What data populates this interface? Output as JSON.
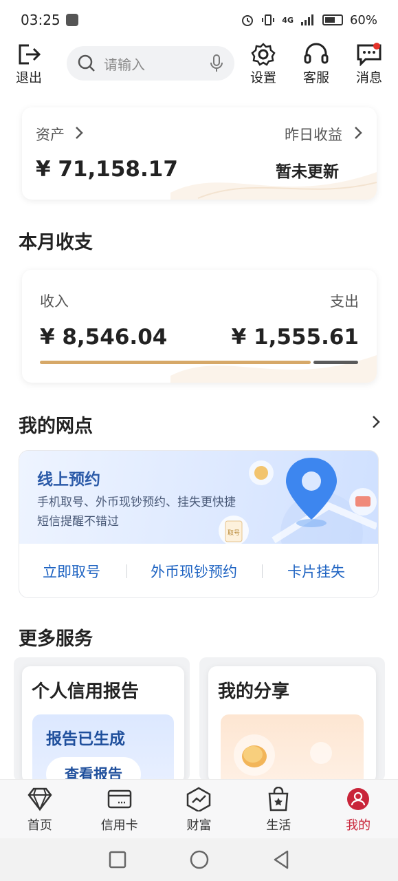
{
  "status": {
    "time": "03:25",
    "signal": "4G",
    "battery": "60%"
  },
  "header": {
    "logout_label": "退出",
    "search_placeholder": "请输入",
    "settings_label": "设置",
    "service_label": "客服",
    "messages_label": "消息"
  },
  "assets": {
    "label": "资产",
    "value": "¥ 71,158.17",
    "yesterday_label": "昨日收益",
    "yesterday_value": "暂未更新"
  },
  "monthly": {
    "title": "本月收支",
    "income_label": "收入",
    "income_value": "¥ 8,546.04",
    "expense_label": "支出",
    "expense_value": "¥ 1,555.61",
    "income_share": 0.85
  },
  "branch": {
    "title": "我的网点",
    "banner_title": "线上预约",
    "banner_line1": "手机取号、外币现钞预约、挂失更快捷",
    "banner_line2": "短信提醒不错过",
    "ticket_text": "取号",
    "links": [
      "立即取号",
      "外币现钞预约",
      "卡片挂失"
    ]
  },
  "more": {
    "title": "更多服务",
    "credit_title": "个人信用报告",
    "credit_status": "报告已生成",
    "credit_button": "查看报告",
    "share_title": "我的分享"
  },
  "tabs": [
    {
      "label": "首页",
      "icon": "diamond-icon"
    },
    {
      "label": "信用卡",
      "icon": "credit-card-icon"
    },
    {
      "label": "财富",
      "icon": "trend-icon"
    },
    {
      "label": "生活",
      "icon": "shopping-bag-icon"
    },
    {
      "label": "我的",
      "icon": "user-icon",
      "active": true
    }
  ],
  "colors": {
    "accent_red": "#c9253a",
    "link_blue": "#1e63c2",
    "income_gold": "#d6a868"
  }
}
